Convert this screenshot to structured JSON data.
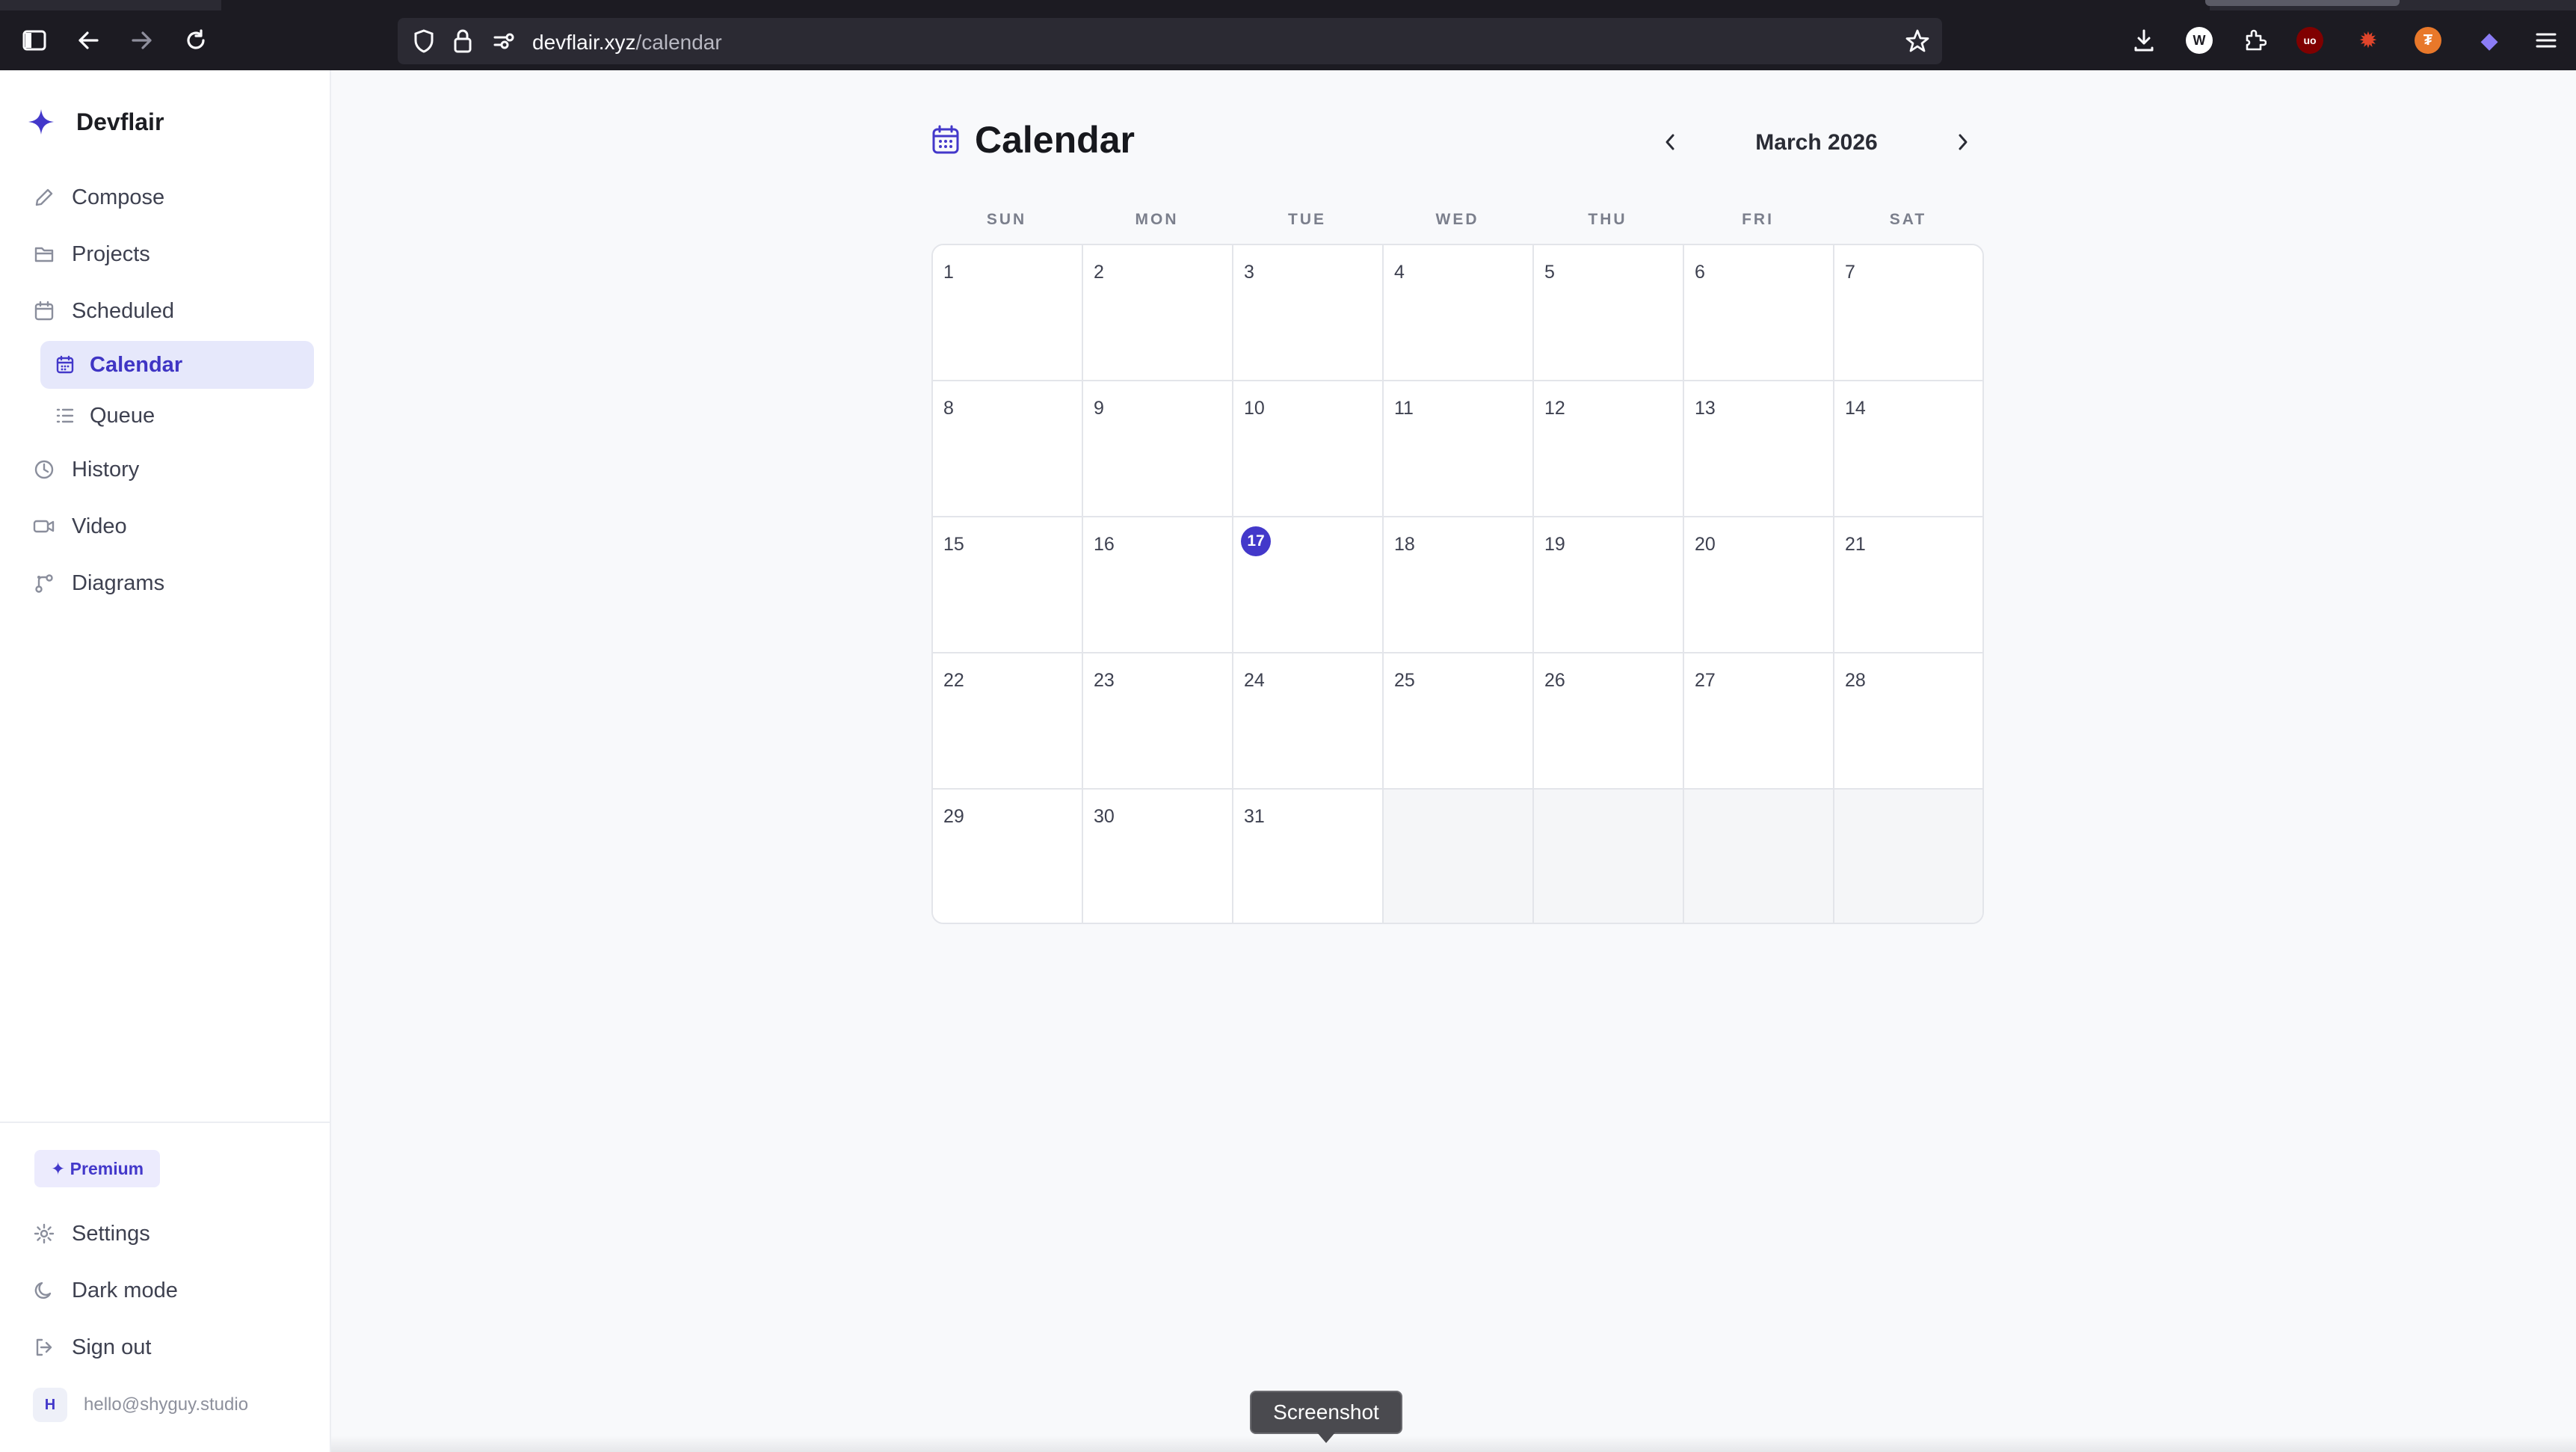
{
  "browser": {
    "url_host": "devflair.xyz",
    "url_path": "/calendar",
    "extensions": [
      {
        "name": "download-icon",
        "glyph": ""
      },
      {
        "name": "w-extension-icon",
        "glyph": "W",
        "color": "#ffffff",
        "text_color": "#1c1b22"
      },
      {
        "name": "extensions-icon",
        "glyph": ""
      },
      {
        "name": "ublock-icon",
        "glyph": "uo",
        "color": "#800000"
      },
      {
        "name": "bug-extension-icon",
        "glyph": "✹",
        "color": "#e0452b"
      },
      {
        "name": "orange-extension-icon",
        "glyph": "₮",
        "color": "#e8782a"
      },
      {
        "name": "purple-extension-icon",
        "glyph": "◆",
        "color": "#8b7cf6"
      }
    ]
  },
  "sidebar": {
    "brand": "Devflair",
    "items": [
      {
        "label": "Compose",
        "icon": "pencil-icon"
      },
      {
        "label": "Projects",
        "icon": "folder-icon"
      },
      {
        "label": "Scheduled",
        "icon": "calendar-icon"
      },
      {
        "label": "History",
        "icon": "clock-icon"
      },
      {
        "label": "Video",
        "icon": "video-icon"
      },
      {
        "label": "Diagrams",
        "icon": "diagram-icon"
      }
    ],
    "sub_items": [
      {
        "label": "Calendar",
        "icon": "calendar-icon",
        "active": true
      },
      {
        "label": "Queue",
        "icon": "list-icon",
        "active": false
      }
    ],
    "premium": "✦ Premium",
    "footer_items": [
      {
        "label": "Settings",
        "icon": "gear-icon"
      },
      {
        "label": "Dark mode",
        "icon": "moon-icon"
      },
      {
        "label": "Sign out",
        "icon": "sign-out-icon"
      }
    ],
    "user": {
      "initial": "H",
      "email": "hello@shyguy.studio"
    }
  },
  "calendar": {
    "title": "Calendar",
    "month": "March 2026",
    "weekdays": [
      "SUN",
      "MON",
      "TUE",
      "WED",
      "THU",
      "FRI",
      "SAT"
    ],
    "first_weekday_index": 0,
    "days_in_month": 31,
    "today": 17
  },
  "tooltip": "Screenshot",
  "colors": {
    "accent": "#4338ca",
    "accent_bg": "#e6e8fb"
  }
}
